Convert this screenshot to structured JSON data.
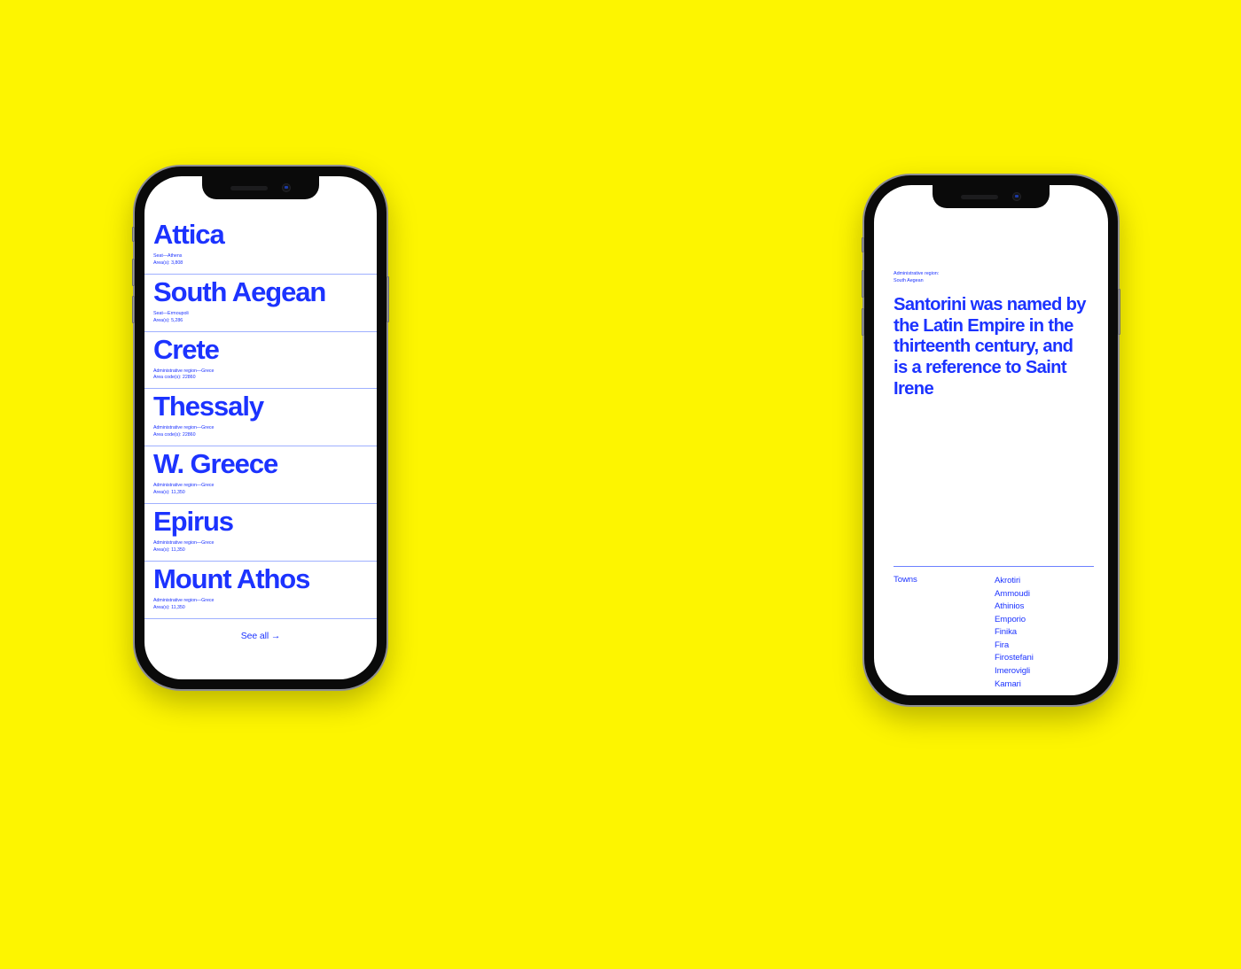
{
  "canvas": {
    "background_color": "#fdf500",
    "accent_color": "#1c33ff",
    "rule_color": "#9fb0ff"
  },
  "phone_one": {
    "name": "regions-list-screen",
    "rows": [
      {
        "title": "Attica",
        "meta_1": "Seat—Athens",
        "meta_2": "Area(s): 3,808"
      },
      {
        "title": "South Aegean",
        "meta_1": "Seat—Ermoupoli",
        "meta_2": "Area(s): 5,286"
      },
      {
        "title": "Crete",
        "meta_1": "Administrative region—Grece",
        "meta_2": "Area code(s): 22860"
      },
      {
        "title": "Thessaly",
        "meta_1": "Administrative region—Grece",
        "meta_2": "Area code(s): 22860"
      },
      {
        "title": "W. Greece",
        "meta_1": "Administrative region—Grece",
        "meta_2": "Area(s): 11,350"
      },
      {
        "title": "Epirus",
        "meta_1": "Administrative region—Grece",
        "meta_2": "Area(s): 11,350"
      },
      {
        "title": "Mount Athos",
        "meta_1": "Administrative region—Grece",
        "meta_2": "Area(s): 11,350"
      }
    ],
    "see_all_label": "See all →"
  },
  "phone_two": {
    "name": "santorini-article-screen",
    "kicker_line_1": "Administrative region:",
    "kicker_line_2": "South Aegean",
    "headline": "Santorini was named by the Latin Empire in the thirteenth century, and is a reference to Saint Irene",
    "towns_label": "Towns",
    "towns": [
      "Akrotiri",
      "Ammoudi",
      "Athinios",
      "Emporio",
      "Finika",
      "Fira",
      "Firostefani",
      "Imerovigli",
      "Kamari"
    ]
  }
}
